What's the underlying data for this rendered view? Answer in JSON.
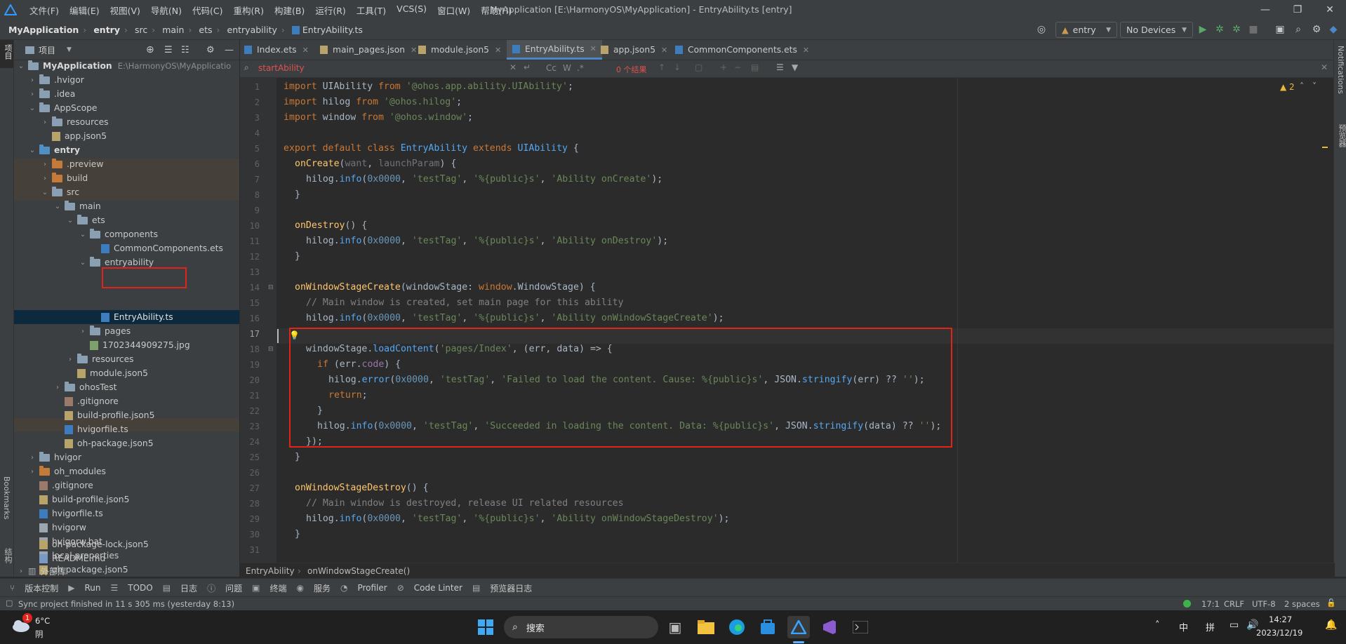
{
  "window": {
    "title": "MyApplication [E:\\HarmonyOS\\MyApplication] - EntryAbility.ts [entry]",
    "menu": [
      "文件(F)",
      "编辑(E)",
      "视图(V)",
      "导航(N)",
      "代码(C)",
      "重构(R)",
      "构建(B)",
      "运行(R)",
      "工具(T)",
      "VCS(S)",
      "窗口(W)",
      "帮助(H)"
    ],
    "controls": {
      "minimize": "—",
      "restore": "❐",
      "close": "✕"
    }
  },
  "breadcrumb": [
    "MyApplication",
    "entry",
    "src",
    "main",
    "ets",
    "entryability",
    "EntryAbility.ts"
  ],
  "toolbar": {
    "run_config": "entry",
    "device": "No Devices"
  },
  "left_stripe": {
    "project": "项目",
    "bookmarks": "Bookmarks",
    "structure": "结构"
  },
  "right_stripe": {
    "notifications": "Notifications",
    "previewer": "预览器"
  },
  "project_panel": {
    "title": "项目",
    "tree": [
      {
        "label": "MyApplication",
        "extra": "E:\\HarmonyOS\\MyApplicatio",
        "icon": "folder",
        "bold": true
      },
      {
        "label": ".hvigor",
        "icon": "folder"
      },
      {
        "label": ".idea",
        "icon": "folder"
      },
      {
        "label": "AppScope",
        "icon": "folder"
      },
      {
        "label": "resources",
        "icon": "folder"
      },
      {
        "label": "app.json5",
        "icon": "json"
      },
      {
        "label": "entry",
        "icon": "folder-blue",
        "bold": true
      },
      {
        "label": ".preview",
        "icon": "folder-orange"
      },
      {
        "label": "build",
        "icon": "folder-orange"
      },
      {
        "label": "src",
        "icon": "folder"
      },
      {
        "label": "main",
        "icon": "folder"
      },
      {
        "label": "ets",
        "icon": "folder"
      },
      {
        "label": "components",
        "icon": "folder"
      },
      {
        "label": "CommonComponents.ets",
        "icon": "ts"
      },
      {
        "label": "entryability",
        "icon": "folder"
      },
      {
        "label": "EntryAbility.ts",
        "icon": "ts"
      },
      {
        "label": "pages",
        "icon": "folder"
      },
      {
        "label": "1702344909275.jpg",
        "icon": "img"
      },
      {
        "label": "resources",
        "icon": "folder"
      },
      {
        "label": "module.json5",
        "icon": "json"
      },
      {
        "label": "ohosTest",
        "icon": "folder"
      },
      {
        "label": ".gitignore",
        "icon": "git"
      },
      {
        "label": "build-profile.json5",
        "icon": "json"
      },
      {
        "label": "hvigorfile.ts",
        "icon": "ts"
      },
      {
        "label": "oh-package.json5",
        "icon": "json"
      },
      {
        "label": "hvigor",
        "icon": "folder"
      },
      {
        "label": "oh_modules",
        "icon": "folder-orange"
      },
      {
        "label": ".gitignore",
        "icon": "git"
      },
      {
        "label": "build-profile.json5",
        "icon": "json"
      },
      {
        "label": "hvigorfile.ts",
        "icon": "ts"
      },
      {
        "label": "hvigorw",
        "icon": "file"
      },
      {
        "label": "hvigorw.bat",
        "icon": "file"
      },
      {
        "label": "local.properties",
        "icon": "file"
      },
      {
        "label": "oh-package.json5",
        "icon": "json"
      },
      {
        "label": "oh-package-lock.json5",
        "icon": "json"
      },
      {
        "label": "README.md",
        "icon": "md"
      },
      {
        "label": "外部库",
        "icon": "lib"
      }
    ]
  },
  "tabs": [
    "Index.ets",
    "main_pages.json",
    "module.json5",
    "EntryAbility.ts",
    "app.json5",
    "CommonComponents.ets"
  ],
  "search": {
    "query": "startAbility",
    "match_case": "Cc",
    "words": "W",
    "regex": ".*",
    "result": "0 个结果"
  },
  "editor": {
    "warnings": "2",
    "line_numbers": [
      "1",
      "2",
      "3",
      "4",
      "5",
      "6",
      "7",
      "8",
      "9",
      "10",
      "11",
      "12",
      "13",
      "14",
      "15",
      "16",
      "17",
      "18",
      "19",
      "20",
      "21",
      "22",
      "23",
      "24",
      "25",
      "26",
      "27",
      "28",
      "29",
      "30",
      "31"
    ]
  },
  "editor_breadcrumb": [
    "EntryAbility",
    "onWindowStageCreate()"
  ],
  "tool_windows": [
    "版本控制",
    "Run",
    "TODO",
    "日志",
    "问题",
    "终端",
    "服务",
    "Profiler",
    "Code Linter",
    "预览器日志"
  ],
  "status": {
    "message": "Sync project finished in 11 s 305 ms (yesterday 8:13)",
    "position": "17:1",
    "line_sep": "CRLF",
    "encoding": "UTF-8",
    "indent": "2 spaces"
  },
  "taskbar": {
    "temp": "6°C",
    "weather": "阴",
    "badge": "1",
    "search": "搜索",
    "ime1": "中",
    "ime2": "拼",
    "time": "14:27",
    "date": "2023/12/19"
  }
}
